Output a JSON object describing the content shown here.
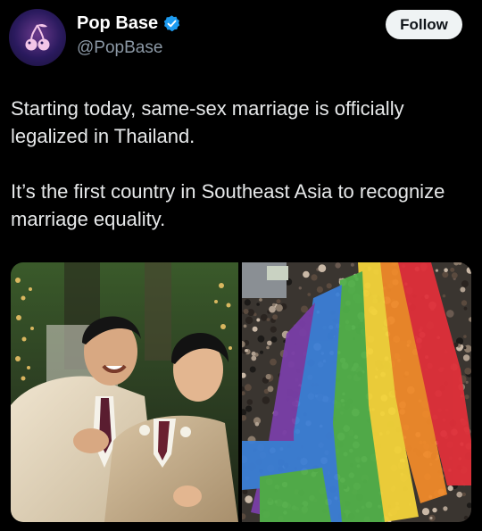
{
  "account": {
    "display_name": "Pop Base",
    "handle": "@PopBase",
    "avatar_icon": "cherries-icon",
    "verified_icon": "verified-badge-icon",
    "verified_color": "#1d9bf0"
  },
  "follow_button": {
    "label": "Follow"
  },
  "tweet": {
    "paragraphs": [
      "Starting today, same-sex marriage is officially legalized in Thailand.",
      "It’s the first country in Southeast Asia to recognize marriage equality."
    ]
  },
  "media": {
    "count": 2,
    "rainbow_colors": [
      "#e0303a",
      "#f08a2a",
      "#f4d43a",
      "#52b04a",
      "#3c7fd6",
      "#7a3fa8"
    ]
  }
}
